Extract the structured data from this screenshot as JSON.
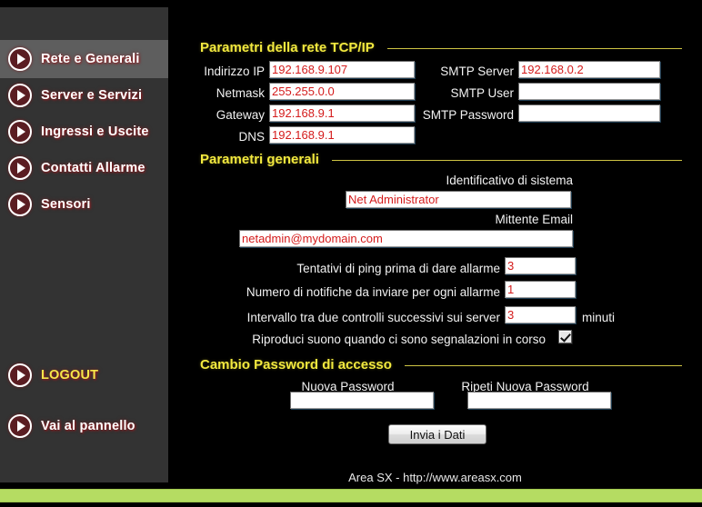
{
  "sidebar": {
    "items": [
      {
        "id": "rete-e-generali",
        "label": "Rete e Generali",
        "icon": "play-circle-icon",
        "active": true
      },
      {
        "id": "server-e-servizi",
        "label": "Server e Servizi",
        "icon": "play-circle-icon",
        "active": false
      },
      {
        "id": "ingressi-e-uscite",
        "label": "Ingressi e Uscite",
        "icon": "play-circle-icon",
        "active": false
      },
      {
        "id": "contatti-allarme",
        "label": "Contatti Allarme",
        "icon": "play-circle-icon",
        "active": false
      },
      {
        "id": "sensori",
        "label": "Sensori",
        "icon": "play-circle-icon",
        "active": false
      }
    ],
    "logout": {
      "label": "LOGOUT",
      "icon": "play-circle-icon"
    },
    "panel": {
      "label": "Vai al pannello",
      "icon": "play-circle-icon"
    }
  },
  "sections": {
    "network": {
      "title": "Parametri della rete TCP/IP",
      "fields": {
        "ip_label": "Indirizzo IP",
        "ip_value": "192.168.9.107",
        "netmask_label": "Netmask",
        "netmask_value": "255.255.0.0",
        "gateway_label": "Gateway",
        "gateway_value": "192.168.9.1",
        "dns_label": "DNS",
        "dns_value": "192.168.9.1",
        "smtp_server_label": "SMTP Server",
        "smtp_server_value": "192.168.0.2",
        "smtp_user_label": "SMTP User",
        "smtp_user_value": "",
        "smtp_password_label": "SMTP Password",
        "smtp_password_value": ""
      }
    },
    "general": {
      "title": "Parametri generali",
      "fields": {
        "system_id_label": "Identificativo di sistema",
        "system_id_value": "Net Administrator",
        "sender_email_label": "Mittente Email",
        "sender_email_value": "netadmin@mydomain.com",
        "ping_attempts_label": "Tentativi di ping prima di dare allarme",
        "ping_attempts_value": "3",
        "notifications_label": "Numero di notifiche da inviare per ogni allarme",
        "notifications_value": "1",
        "interval_label": "Intervallo tra due controlli successivi sui server",
        "interval_value": "3",
        "interval_unit": "minuti",
        "sound_label": "Riproduci suono quando ci sono segnalazioni in corso",
        "sound_checked": true
      }
    },
    "password": {
      "title": "Cambio Password di accesso",
      "fields": {
        "new_password_label": "Nuova Password",
        "new_password_value": "",
        "repeat_password_label": "Ripeti Nuova Password",
        "repeat_password_value": ""
      }
    }
  },
  "submit": {
    "label": "Invia i Dati"
  },
  "footer": {
    "text": "Area SX - http://www.areasx.com"
  },
  "colors": {
    "accent_yellow": "#f2e93f",
    "field_text_red": "#d41b1b",
    "sidebar_bg": "#333333",
    "sidebar_active": "#5e5e5e",
    "icon_red": "#5a1d22",
    "band_green": "#b5dc62"
  }
}
